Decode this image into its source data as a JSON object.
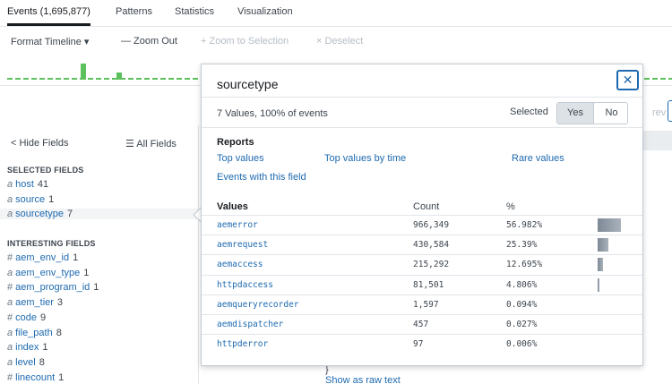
{
  "tabs": [
    {
      "label": "Events (1,695,877)",
      "active": true
    },
    {
      "label": "Patterns",
      "active": false
    },
    {
      "label": "Statistics",
      "active": false
    },
    {
      "label": "Visualization",
      "active": false
    }
  ],
  "toolbar": {
    "format_timeline": "Format Timeline ▾",
    "zoom_out": "— Zoom Out",
    "zoom_selection": "+ Zoom to Selection",
    "deselect": "× Deselect"
  },
  "timeline": {
    "bar_color": "#5cc05c",
    "relative_heights": [
      0.7,
      0.3,
      0.35,
      0.35,
      0.35,
      0.35,
      0.35
    ]
  },
  "sidebar": {
    "hide_fields": "< Hide Fields",
    "all_fields": "☰ All Fields",
    "selected_title": "SELECTED FIELDS",
    "selected_fields": [
      {
        "type": "a",
        "name": "host",
        "count": "41"
      },
      {
        "type": "a",
        "name": "source",
        "count": "1"
      },
      {
        "type": "a",
        "name": "sourcetype",
        "count": "7"
      }
    ],
    "interesting_title": "INTERESTING FIELDS",
    "interesting_fields": [
      {
        "type": "#",
        "name": "aem_env_id",
        "count": "1"
      },
      {
        "type": "a",
        "name": "aem_env_type",
        "count": "1"
      },
      {
        "type": "#",
        "name": "aem_program_id",
        "count": "1"
      },
      {
        "type": "a",
        "name": "aem_tier",
        "count": "3"
      },
      {
        "type": "#",
        "name": "code",
        "count": "9"
      },
      {
        "type": "a",
        "name": "file_path",
        "count": "8"
      },
      {
        "type": "a",
        "name": "index",
        "count": "1"
      },
      {
        "type": "a",
        "name": "level",
        "count": "8"
      },
      {
        "type": "#",
        "name": "linecount",
        "count": "1"
      }
    ]
  },
  "background": {
    "prev_fragment": "rev",
    "raw_brace": "}",
    "show_raw": "Show as raw text"
  },
  "popup": {
    "title": "sourcetype",
    "close_label": "✕",
    "summary": "7 Values, 100% of events",
    "selected_label": "Selected",
    "yes_label": "Yes",
    "no_label": "No",
    "reports_title": "Reports",
    "reports": {
      "top_values": "Top values",
      "top_values_by_time": "Top values by time",
      "rare_values": "Rare values",
      "events_with_field": "Events with this field"
    },
    "table_headers": {
      "values": "Values",
      "count": "Count",
      "percent": "%"
    },
    "rows": [
      {
        "value": "aemerror",
        "count": "966,349",
        "pct": "56.982%",
        "fraction": 0.56982
      },
      {
        "value": "aemrequest",
        "count": "430,584",
        "pct": "25.39%",
        "fraction": 0.2539
      },
      {
        "value": "aemaccess",
        "count": "215,292",
        "pct": "12.695%",
        "fraction": 0.12695
      },
      {
        "value": "httpdaccess",
        "count": "81,501",
        "pct": "4.806%",
        "fraction": 0.04806
      },
      {
        "value": "aemqueryrecorder",
        "count": "1,597",
        "pct": "0.094%",
        "fraction": 0.00094
      },
      {
        "value": "aemdispatcher",
        "count": "457",
        "pct": "0.027%",
        "fraction": 0.00027
      },
      {
        "value": "httpderror",
        "count": "97",
        "pct": "0.006%",
        "fraction": 6e-05
      }
    ]
  }
}
